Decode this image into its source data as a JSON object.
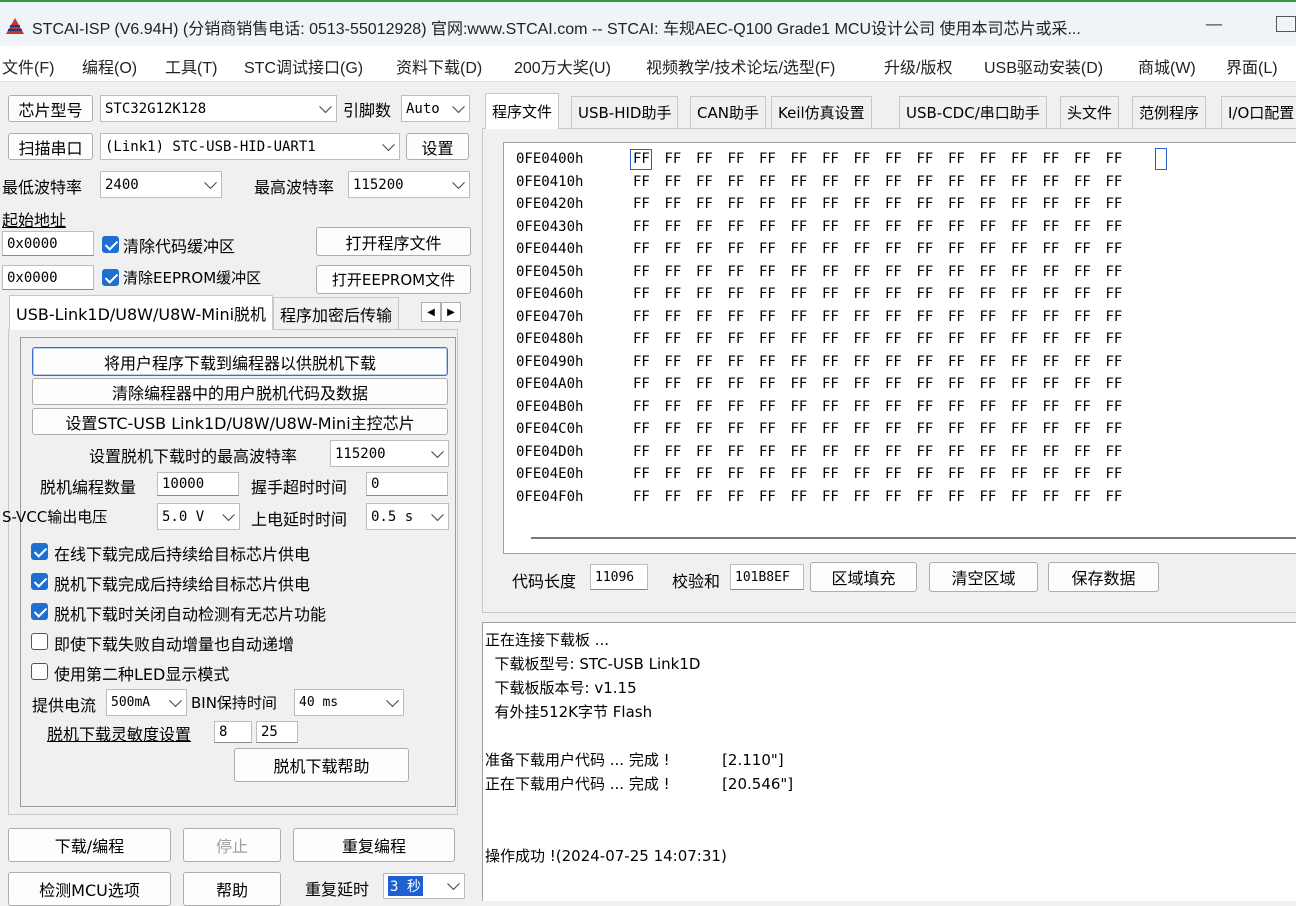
{
  "window": {
    "title": "STCAI-ISP (V6.94H) (分销商销售电话: 0513-55012928) 官网:www.STCAI.com  -- STCAI: 车规AEC-Q100 Grade1 MCU设计公司 使用本司芯片或采...",
    "minimize": "—"
  },
  "menu": [
    "文件(F)",
    "编程(O)",
    "工具(T)",
    "STC调试接口(G)",
    "资料下载(D)",
    "200万大奖(U)",
    "视频教学/技术论坛/选型(F)",
    "升级/版权",
    "USB驱动安装(D)",
    "商城(W)",
    "界面(L)"
  ],
  "left": {
    "chip_type_btn": "芯片型号",
    "chip_type_value": "STC32G12K128",
    "pin_count_label": "引脚数",
    "pin_count_value": "Auto",
    "scan_port_btn": "扫描串口",
    "port_value": "(Link1) STC-USB-HID-UART1",
    "settings_btn": "设置",
    "min_baud_label": "最低波特率",
    "min_baud_value": "2400",
    "max_baud_label": "最高波特率",
    "max_baud_value": "115200",
    "start_addr_label": "起始地址",
    "addr1_value": "0x0000",
    "clear_code_label": "清除代码缓冲区",
    "open_program_btn": "打开程序文件",
    "addr2_value": "0x0000",
    "clear_eeprom_label": "清除EEPROM缓冲区",
    "open_eeprom_btn": "打开EEPROM文件",
    "tabs": [
      "USB-Link1D/U8W/U8W-Mini脱机",
      "程序加密后传输"
    ]
  },
  "offline": {
    "btn_download_to_programmer": "将用户程序下载到编程器以供脱机下载",
    "btn_clear_programmer": "清除编程器中的用户脱机代码及数据",
    "btn_set_master": "设置STC-USB Link1D/U8W/U8W-Mini主控芯片",
    "max_baud_label": "设置脱机下载时的最高波特率",
    "max_baud_value": "115200",
    "prog_count_label": "脱机编程数量",
    "prog_count_value": "10000",
    "handshake_label": "握手超时时间",
    "handshake_value": "0",
    "svcc_label": "S-VCC输出电压",
    "svcc_value": "5.0 V",
    "power_delay_label": "上电延时时间",
    "power_delay_value": "0.5 s",
    "checks": [
      {
        "label": "在线下载完成后持续给目标芯片供电",
        "checked": true
      },
      {
        "label": "脱机下载完成后持续给目标芯片供电",
        "checked": true
      },
      {
        "label": "脱机下载时关闭自动检测有无芯片功能",
        "checked": true
      },
      {
        "label": "即使下载失败自动增量也自动递增",
        "checked": false
      },
      {
        "label": "使用第二种LED显示模式",
        "checked": false
      }
    ],
    "current_label": "提供电流",
    "current_value": "500mA",
    "bin_hold_label": "BIN保持时间",
    "bin_hold_value": "40 ms",
    "sensitivity_label": "脱机下载灵敏度设置",
    "sens1": "8",
    "sens2": "25",
    "help_btn": "脱机下载帮助"
  },
  "bottom": {
    "download_btn": "下载/编程",
    "stop_btn": "停止",
    "reprogram_btn": "重复编程",
    "detect_btn": "检测MCU选项",
    "help_btn": "帮助",
    "repeat_delay_label": "重复延时",
    "repeat_delay_value": "3 秒"
  },
  "right_tabs": [
    "程序文件",
    "USB-HID助手",
    "CAN助手",
    "Keil仿真设置",
    "USB-CDC/串口助手",
    "头文件",
    "范例程序",
    "I/O口配置"
  ],
  "hex": {
    "addresses": [
      "0FE0400h",
      "0FE0410h",
      "0FE0420h",
      "0FE0430h",
      "0FE0440h",
      "0FE0450h",
      "0FE0460h",
      "0FE0470h",
      "0FE0480h",
      "0FE0490h",
      "0FE04A0h",
      "0FE04B0h",
      "0FE04C0h",
      "0FE04D0h",
      "0FE04E0h",
      "0FE04F0h"
    ],
    "fill_byte": "FF"
  },
  "code_footer": {
    "length_label": "代码长度",
    "length_value": "11096",
    "checksum_label": "校验和",
    "checksum_value": "101B8EF",
    "fill_btn": "区域填充",
    "clear_btn": "清空区域",
    "save_btn": "保存数据"
  },
  "log": [
    "正在连接下载板 ...",
    "  下载板型号: STC-USB Link1D",
    "  下载板版本号: v1.15",
    "  有外挂512K字节 Flash",
    "",
    "准备下载用户代码 ... 完成 !           [2.110\"]",
    "正在下载用户代码 ... 完成 !           [20.546\"]",
    "",
    "",
    "操作成功 !(2024-07-25 14:07:31)"
  ]
}
